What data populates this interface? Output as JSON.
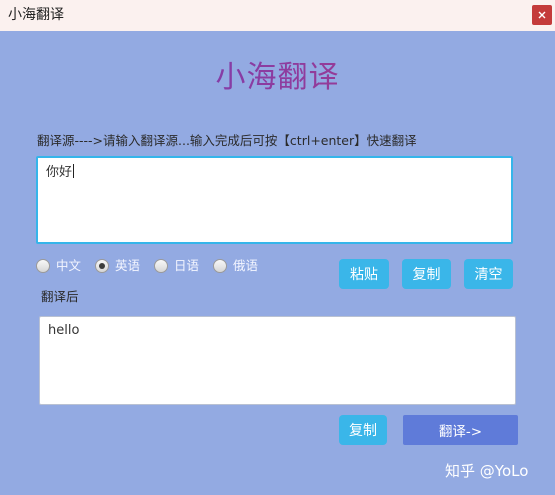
{
  "window": {
    "title": "小海翻译",
    "close_label": "×"
  },
  "app": {
    "title": "小海翻译"
  },
  "source": {
    "label": "翻译源---->请输入翻译源...输入完成后可按【ctrl+enter】快速翻译",
    "value": "你好"
  },
  "languages": {
    "options": [
      {
        "label": "中文",
        "checked": false
      },
      {
        "label": "英语",
        "checked": true
      },
      {
        "label": "日语",
        "checked": false
      },
      {
        "label": "俄语",
        "checked": false
      }
    ]
  },
  "source_actions": {
    "paste_label": "粘贴",
    "copy_label": "复制",
    "clear_label": "清空"
  },
  "result": {
    "label": "翻译后",
    "value": "hello"
  },
  "result_actions": {
    "copy_label": "复制",
    "translate_label": "翻译->"
  },
  "watermark": {
    "text": "知乎 @YoLo"
  },
  "colors": {
    "background": "#93aae2",
    "accent_button": "#3ab6e9",
    "translate_button": "#5f7bd9",
    "close_button": "#c43b3b"
  }
}
